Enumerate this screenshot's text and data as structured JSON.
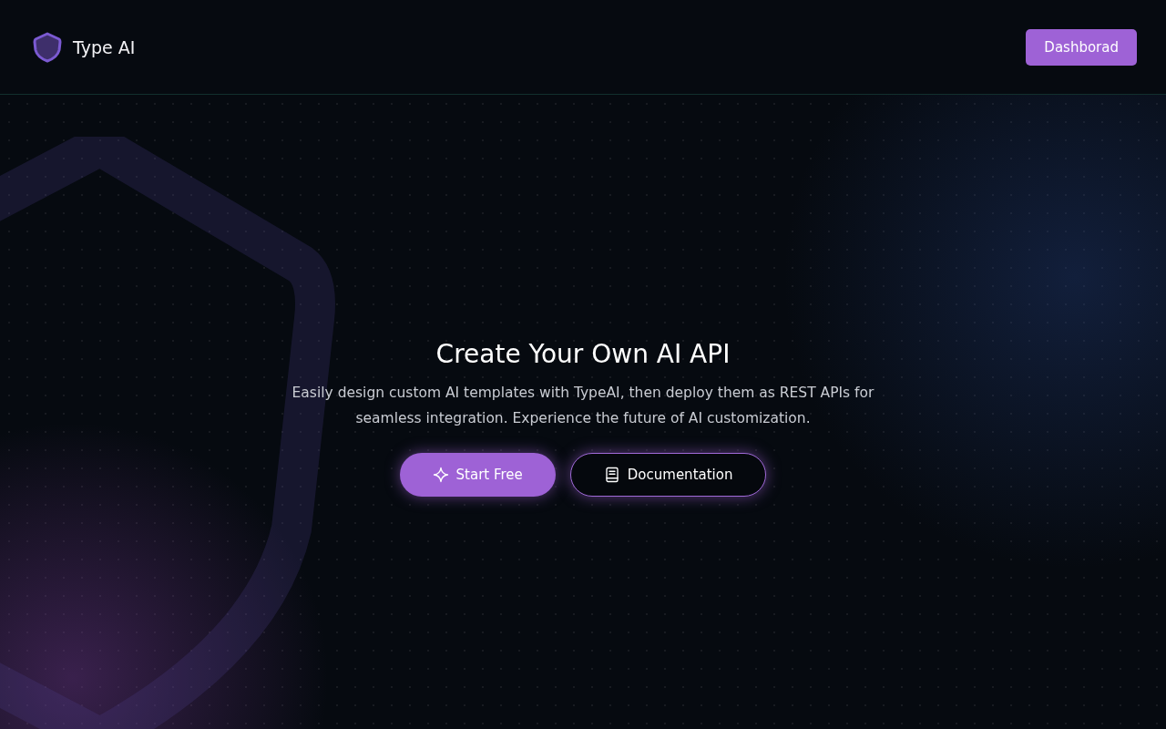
{
  "header": {
    "brand": "Type AI",
    "dashboard_button": "Dashborad"
  },
  "hero": {
    "title": "Create Your Own AI API",
    "subtitle": "Easily design custom AI templates with TypeAI, then deploy them as REST APIs for seamless integration. Experience the future of AI customization.",
    "buttons": [
      {
        "kind": "primary",
        "label": "Start Free"
      },
      {
        "kind": "secondary",
        "label": "Documentation"
      }
    ]
  }
}
